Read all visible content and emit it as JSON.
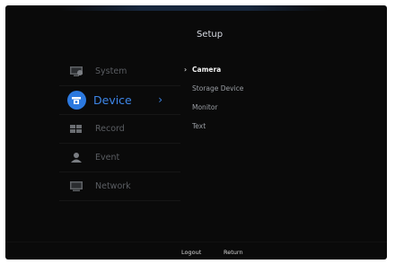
{
  "header": {
    "title": "Setup"
  },
  "menu": {
    "items": [
      {
        "label": "System",
        "icon": "system-icon",
        "active": false
      },
      {
        "label": "Device",
        "icon": "device-icon",
        "active": true
      },
      {
        "label": "Record",
        "icon": "record-icon",
        "active": false
      },
      {
        "label": "Event",
        "icon": "event-icon",
        "active": false
      },
      {
        "label": "Network",
        "icon": "network-icon",
        "active": false
      }
    ],
    "active_arrow": "›"
  },
  "submenu": {
    "items": [
      {
        "label": "Camera",
        "selected": true
      },
      {
        "label": "Storage Device",
        "selected": false
      },
      {
        "label": "Monitor",
        "selected": false
      },
      {
        "label": "Text",
        "selected": false
      }
    ],
    "selected_marker": "›"
  },
  "footer": {
    "logout_label": "Logout",
    "return_label": "Return"
  },
  "colors": {
    "background": "#0a0a0a",
    "accent": "#2c79df",
    "text_inactive": "#5a5d62"
  }
}
